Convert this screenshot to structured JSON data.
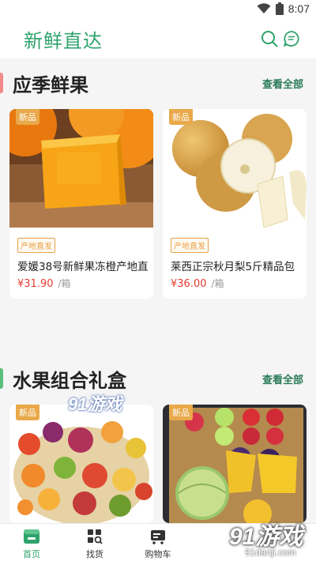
{
  "status_bar": {
    "time": "8:07",
    "icons": [
      "wifi-icon",
      "battery-icon"
    ]
  },
  "header": {
    "logo_text": "新鲜直达",
    "icons": [
      "search-icon",
      "message-icon"
    ]
  },
  "sections": [
    {
      "title": "应季鲜果",
      "view_all": "查看全部",
      "accent_color": "#f28a8a",
      "products": [
        {
          "badge": "新品",
          "tag": "产地直发",
          "name": "爱媛38号新鲜果冻橙产地直",
          "price": "¥31.90",
          "unit": "/箱"
        },
        {
          "badge": "新品",
          "tag": "产地直发",
          "name": "莱西正宗秋月梨5斤精品包",
          "price": "¥36.00",
          "unit": "/箱"
        }
      ]
    },
    {
      "title": "水果组合礼盒",
      "view_all": "查看全部",
      "accent_color": "#5bbf7a",
      "products": [
        {
          "badge": "新品"
        },
        {
          "badge": "新品"
        }
      ]
    }
  ],
  "tabbar": {
    "tabs": [
      {
        "label": "首页",
        "icon": "home-icon",
        "active": true
      },
      {
        "label": "找货",
        "icon": "grid-search-icon",
        "active": false
      },
      {
        "label": "购物车",
        "icon": "cart-icon",
        "active": false
      }
    ]
  },
  "watermarks": {
    "top": "91游戏",
    "bottom": "91游戏",
    "bottom_url": "91danji.com"
  },
  "colors": {
    "brand": "#2ea36b",
    "price": "#e63b2e",
    "tag": "#e9a046"
  }
}
